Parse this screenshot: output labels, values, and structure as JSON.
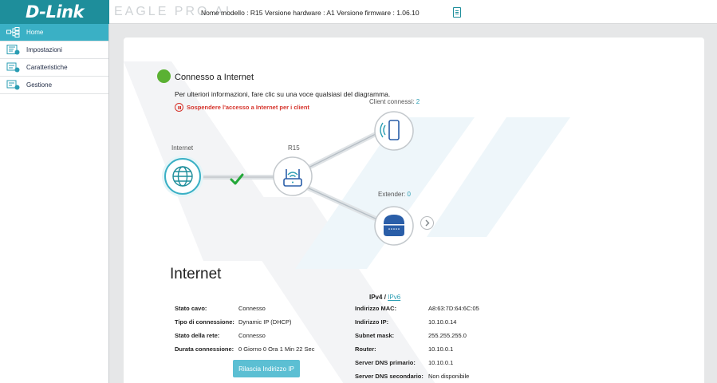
{
  "header": {
    "logo": "D-Link",
    "brand": "EAGLE PRO AI",
    "model_info": "Nome modello : R15 Versione hardware : A1 Versione firmware : 1.06.10",
    "doc_icon": "document-icon"
  },
  "sidebar": {
    "items": [
      {
        "label": "Home",
        "icon": "network-map-icon",
        "active": true
      },
      {
        "label": "Impostazioni",
        "icon": "settings-icon",
        "active": false
      },
      {
        "label": "Caratteristiche",
        "icon": "features-icon",
        "active": false
      },
      {
        "label": "Gestione",
        "icon": "management-icon",
        "active": false
      }
    ]
  },
  "status": {
    "title": "Connesso a Internet",
    "info": "Per ulteriori informazioni, fare clic su una voce qualsiasi del diagramma.",
    "suspend": "Sospendere l'accesso a Internet per i client"
  },
  "diagram": {
    "internet_label": "Internet",
    "router_label": "R15",
    "clients_label": "Client connessi:",
    "clients_count": "2",
    "extender_label": "Extender:",
    "extender_count": "0"
  },
  "internet": {
    "title": "Internet",
    "left": [
      {
        "k": "Stato cavo:",
        "v": "Connesso"
      },
      {
        "k": "Tipo di connessione:",
        "v": "Dynamic IP (DHCP)"
      },
      {
        "k": "Stato della rete:",
        "v": "Connesso"
      },
      {
        "k": "Durata connessione:",
        "v": "0 Giorno 0 Ora 1 Min 22 Sec"
      }
    ],
    "ipv4": "IPv4",
    "sep": "/",
    "ipv6": "IPv6",
    "right": [
      {
        "k": "Indirizzo MAC:",
        "v": "A8:63:7D:64:6C:05"
      },
      {
        "k": "Indirizzo IP:",
        "v": "10.10.0.14"
      },
      {
        "k": "Subnet mask:",
        "v": "255.255.255.0"
      },
      {
        "k": "Router:",
        "v": "10.10.0.1"
      },
      {
        "k": "Server DNS primario:",
        "v": "10.10.0.1"
      },
      {
        "k": "Server DNS secondario:",
        "v": "Non disponibile"
      }
    ],
    "release_button": "Rilascia Indirizzo IP"
  },
  "colors": {
    "accent": "#3ab0c5",
    "logo_bg": "#1e8e9b",
    "connected": "#5bb133",
    "warning": "#d6342c"
  }
}
